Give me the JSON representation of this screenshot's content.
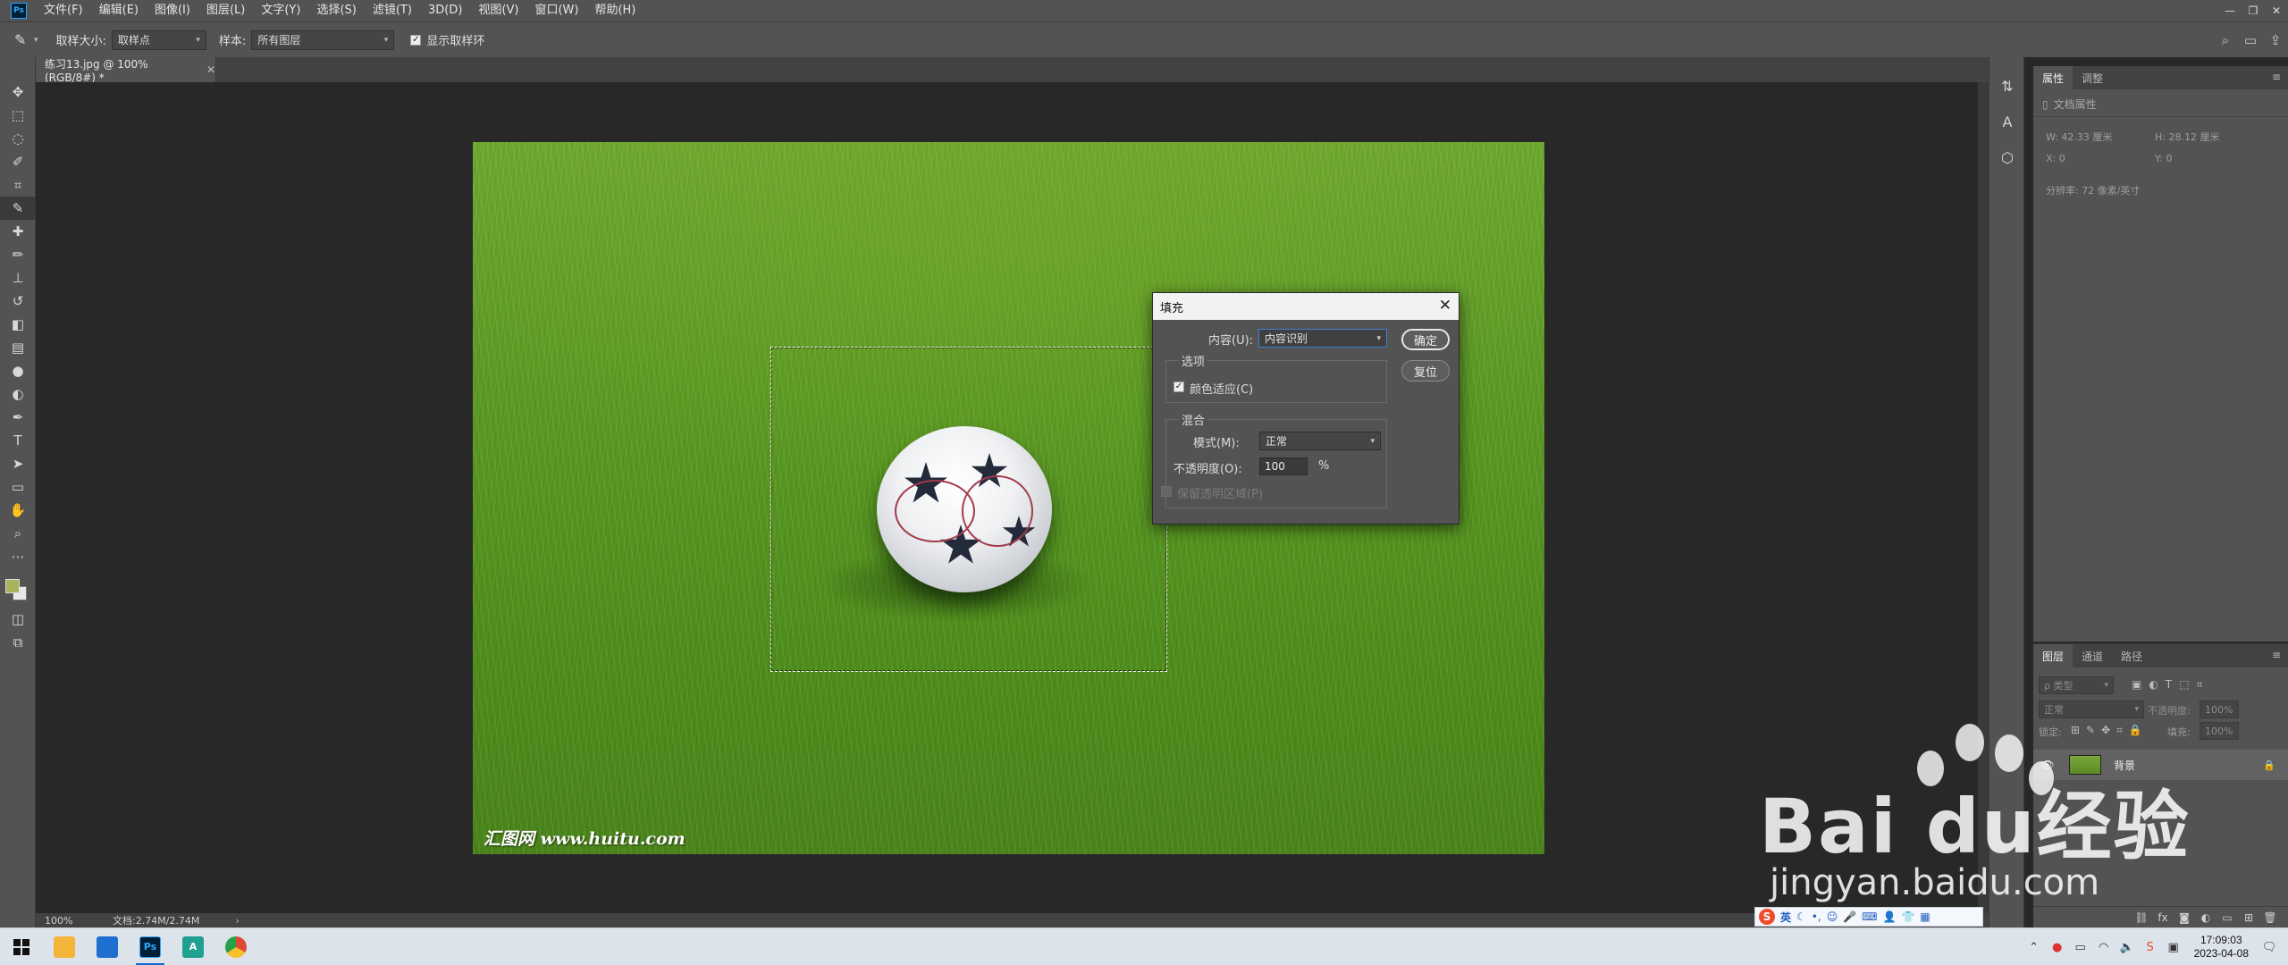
{
  "app": {
    "logo": "Ps",
    "menu": [
      "文件(F)",
      "编辑(E)",
      "图像(I)",
      "图层(L)",
      "文字(Y)",
      "选择(S)",
      "滤镜(T)",
      "3D(D)",
      "视图(V)",
      "窗口(W)",
      "帮助(H)"
    ]
  },
  "options": {
    "sample_size_label": "取样大小:",
    "sample_size_value": "取样点",
    "sample_label": "样本:",
    "sample_value": "所有图层",
    "show_ring_label": "显示取样环",
    "show_ring_checked": true
  },
  "document": {
    "tab_title": "练习13.jpg @ 100%(RGB/8#) *",
    "watermark": "汇图网 www.huitu.com",
    "zoom": "100%",
    "doc_size": "文档:2.74M/2.74M"
  },
  "dialog": {
    "title": "填充",
    "content_label": "内容(U):",
    "content_value": "内容识别",
    "ok_label": "确定",
    "reset_label": "复位",
    "options_group": "选项",
    "color_adapt_label": "颜色适应(C)",
    "color_adapt_checked": true,
    "blend_group": "混合",
    "mode_label": "模式(M):",
    "mode_value": "正常",
    "opacity_label": "不透明度(O):",
    "opacity_value": "100",
    "opacity_unit": "%",
    "preserve_label": "保留透明区域(P)"
  },
  "properties": {
    "tab_properties": "属性",
    "tab_adjust": "调整",
    "doc_props": "文档属性",
    "w": "W:  42.33 厘米",
    "h": "H:  28.12 厘米",
    "x": "X:  0",
    "y": "Y:  0",
    "resolution": "分辨率: 72 像素/英寸"
  },
  "layers": {
    "tab_layers": "图层",
    "tab_channels": "通道",
    "tab_paths": "路径",
    "filter_placeholder": "ρ 类型",
    "blend_mode": "正常",
    "opacity_label": "不透明度:",
    "opacity_value": "100%",
    "lock_label": "锁定:",
    "fill_label": "填充:",
    "fill_value": "100%",
    "layer_name": "背景"
  },
  "ime": {
    "logo": "S",
    "lang": "英"
  },
  "watermark": {
    "brand": "Bai  du经验",
    "url": "jingyan.baidu.com"
  },
  "taskbar": {
    "time": "17:09:03",
    "date": "2023-04-08",
    "apps": [
      {
        "name": "file-explorer",
        "label": "",
        "color": "#f2b53a"
      },
      {
        "name": "outlook",
        "label": "",
        "color": "#1e6fd0"
      },
      {
        "name": "photoshop",
        "label": "Ps",
        "color": "#001e36"
      },
      {
        "name": "app-a",
        "label": "A",
        "color": "#20a090"
      },
      {
        "name": "browser",
        "label": "",
        "color": "#e04836"
      }
    ]
  }
}
